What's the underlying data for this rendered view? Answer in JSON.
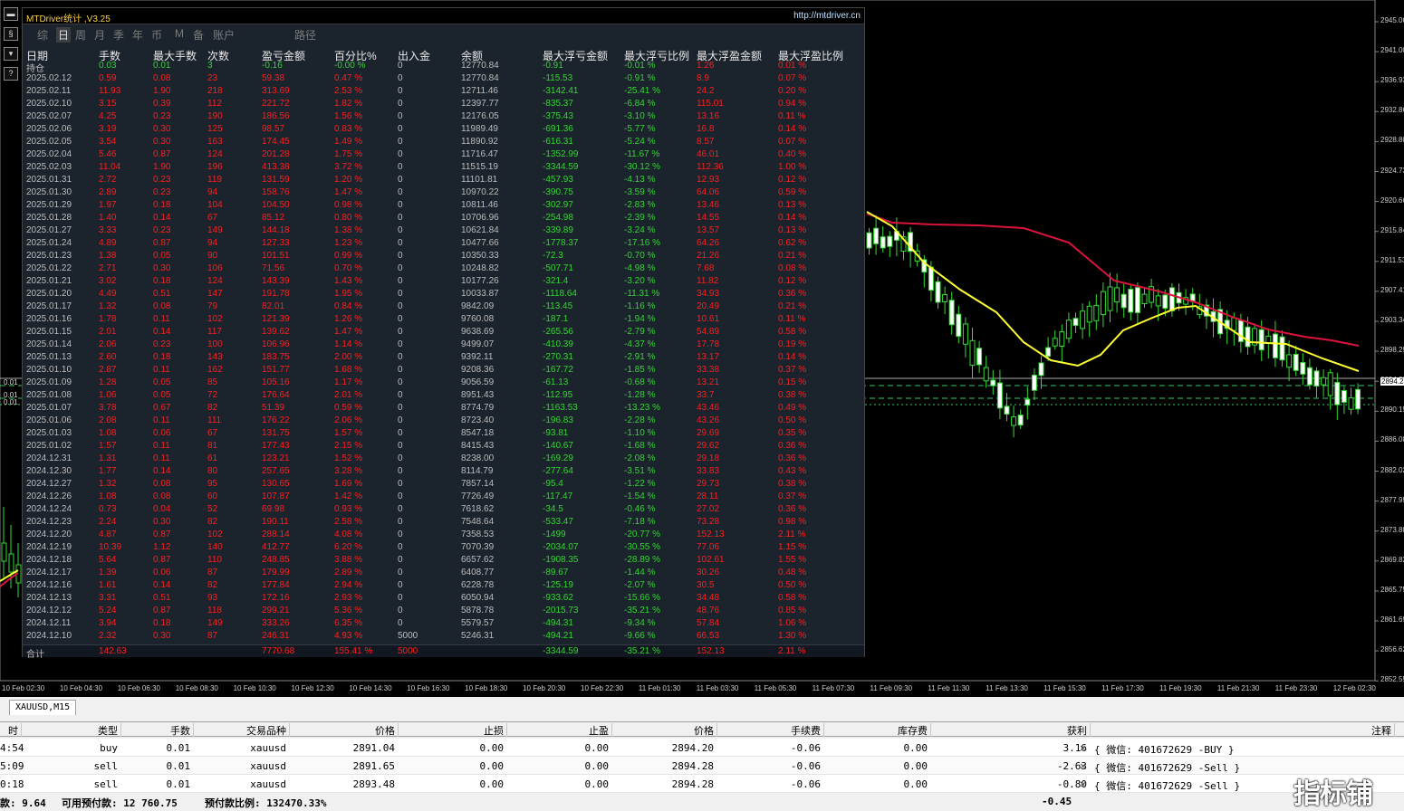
{
  "panel": {
    "title": "MTDriver统计 ,V3.25",
    "url": "http://mtdriver.cn",
    "tabs": [
      "综",
      "日",
      "周",
      "月",
      "季",
      "年",
      "币",
      "M",
      "备",
      "账户",
      "",
      "路径"
    ],
    "active_tab": 1,
    "headers": [
      "日期",
      "手数",
      "最大手数",
      "次数",
      "盈亏金额",
      "百分比%",
      "出入金",
      "余额",
      "最大浮亏金额",
      "最大浮亏比例",
      "最大浮盈金额",
      "最大浮盈比例"
    ],
    "holding": [
      "持仓",
      "0.03",
      "0.01",
      "3",
      "-0.16",
      "-0.00 %",
      "0",
      "12770.84",
      "-0.91",
      "-0.01 %",
      "1.26",
      "0.01 %"
    ],
    "rows": [
      [
        "2025.02.12",
        "0.59",
        "0.08",
        "23",
        "59.38",
        "0.47 %",
        "0",
        "12770.84",
        "-115.53",
        "-0.91 %",
        "8.9",
        "0.07 %"
      ],
      [
        "2025.02.11",
        "11.93",
        "1.90",
        "218",
        "313.69",
        "2.53 %",
        "0",
        "12711.46",
        "-3142.41",
        "-25.41 %",
        "24.2",
        "0.20 %"
      ],
      [
        "2025.02.10",
        "3.15",
        "0.39",
        "112",
        "221.72",
        "1.82 %",
        "0",
        "12397.77",
        "-835.37",
        "-6.84 %",
        "115.01",
        "0.94 %"
      ],
      [
        "2025.02.07",
        "4.25",
        "0.23",
        "190",
        "186.56",
        "1.56 %",
        "0",
        "12176.05",
        "-375.43",
        "-3.10 %",
        "13.16",
        "0.11 %"
      ],
      [
        "2025.02.06",
        "3.19",
        "0.30",
        "125",
        "98.57",
        "0.83 %",
        "0",
        "11989.49",
        "-691.36",
        "-5.77 %",
        "16.8",
        "0.14 %"
      ],
      [
        "2025.02.05",
        "3.54",
        "0.30",
        "163",
        "174.45",
        "1.49 %",
        "0",
        "11890.92",
        "-616.31",
        "-5.24 %",
        "8.57",
        "0.07 %"
      ],
      [
        "2025.02.04",
        "5.46",
        "0.87",
        "124",
        "201.28",
        "1.75 %",
        "0",
        "11716.47",
        "-1352.99",
        "-11.67 %",
        "46.01",
        "0.40 %"
      ],
      [
        "2025.02.03",
        "11.04",
        "1.90",
        "196",
        "413.38",
        "3.72 %",
        "0",
        "11515.19",
        "-3344.59",
        "-30.12 %",
        "112.36",
        "1.00 %"
      ],
      [
        "2025.01.31",
        "2.72",
        "0.23",
        "119",
        "131.59",
        "1.20 %",
        "0",
        "11101.81",
        "-457.93",
        "-4.13 %",
        "12.93",
        "0.12 %"
      ],
      [
        "2025.01.30",
        "2.89",
        "0.23",
        "94",
        "158.76",
        "1.47 %",
        "0",
        "10970.22",
        "-390.75",
        "-3.59 %",
        "64.06",
        "0.59 %"
      ],
      [
        "2025.01.29",
        "1.97",
        "0.18",
        "104",
        "104.50",
        "0.98 %",
        "0",
        "10811.46",
        "-302.97",
        "-2.83 %",
        "13.46",
        "0.13 %"
      ],
      [
        "2025.01.28",
        "1.40",
        "0.14",
        "67",
        "85.12",
        "0.80 %",
        "0",
        "10706.96",
        "-254.98",
        "-2.39 %",
        "14.55",
        "0.14 %"
      ],
      [
        "2025.01.27",
        "3.33",
        "0.23",
        "149",
        "144.18",
        "1.38 %",
        "0",
        "10621.84",
        "-339.89",
        "-3.24 %",
        "13.57",
        "0.13 %"
      ],
      [
        "2025.01.24",
        "4.89",
        "0.87",
        "94",
        "127.33",
        "1.23 %",
        "0",
        "10477.66",
        "-1778.37",
        "-17.16 %",
        "64.26",
        "0.62 %"
      ],
      [
        "2025.01.23",
        "1.38",
        "0.05",
        "90",
        "101.51",
        "0.99 %",
        "0",
        "10350.33",
        "-72.3",
        "-0.70 %",
        "21.26",
        "0.21 %"
      ],
      [
        "2025.01.22",
        "2.71",
        "0.30",
        "106",
        "71.56",
        "0.70 %",
        "0",
        "10248.82",
        "-507.71",
        "-4.98 %",
        "7.68",
        "0.08 %"
      ],
      [
        "2025.01.21",
        "3.02",
        "0.18",
        "124",
        "143.39",
        "1.43 %",
        "0",
        "10177.26",
        "-321.4",
        "-3.20 %",
        "11.82",
        "0.12 %"
      ],
      [
        "2025.01.20",
        "4.49",
        "0.51",
        "147",
        "191.78",
        "1.95 %",
        "0",
        "10033.87",
        "-1118.64",
        "-11.31 %",
        "34.93",
        "0.36 %"
      ],
      [
        "2025.01.17",
        "1.32",
        "0.08",
        "79",
        "82.01",
        "0.84 %",
        "0",
        "9842.09",
        "-113.45",
        "-1.16 %",
        "20.49",
        "0.21 %"
      ],
      [
        "2025.01.16",
        "1.78",
        "0.11",
        "102",
        "121.39",
        "1.26 %",
        "0",
        "9760.08",
        "-187.1",
        "-1.94 %",
        "10.61",
        "0.11 %"
      ],
      [
        "2025.01.15",
        "2.01",
        "0.14",
        "117",
        "139.62",
        "1.47 %",
        "0",
        "9638.69",
        "-265.56",
        "-2.79 %",
        "54.89",
        "0.58 %"
      ],
      [
        "2025.01.14",
        "2.06",
        "0.23",
        "100",
        "106.96",
        "1.14 %",
        "0",
        "9499.07",
        "-410.39",
        "-4.37 %",
        "17.78",
        "0.19 %"
      ],
      [
        "2025.01.13",
        "2.60",
        "0.18",
        "143",
        "183.75",
        "2.00 %",
        "0",
        "9392.11",
        "-270.31",
        "-2.91 %",
        "13.17",
        "0.14 %"
      ],
      [
        "2025.01.10",
        "2.87",
        "0.11",
        "162",
        "151.77",
        "1.68 %",
        "0",
        "9208.36",
        "-167.72",
        "-1.85 %",
        "33.38",
        "0.37 %"
      ],
      [
        "2025.01.09",
        "1.28",
        "0.05",
        "85",
        "105.16",
        "1.17 %",
        "0",
        "9056.59",
        "-61.13",
        "-0.68 %",
        "13.21",
        "0.15 %"
      ],
      [
        "2025.01.08",
        "1.06",
        "0.05",
        "72",
        "176.64",
        "2.01 %",
        "0",
        "8951.43",
        "-112.95",
        "-1.28 %",
        "33.7",
        "0.38 %"
      ],
      [
        "2025.01.07",
        "3.78",
        "0.67",
        "82",
        "51.39",
        "0.59 %",
        "0",
        "8774.79",
        "-1163.53",
        "-13.23 %",
        "43.46",
        "0.49 %"
      ],
      [
        "2025.01.06",
        "2.08",
        "0.11",
        "111",
        "176.22",
        "2.06 %",
        "0",
        "8723.40",
        "-196.83",
        "-2.28 %",
        "43.26",
        "0.50 %"
      ],
      [
        "2025.01.03",
        "1.08",
        "0.06",
        "67",
        "131.75",
        "1.57 %",
        "0",
        "8547.18",
        "-93.81",
        "-1.10 %",
        "29.69",
        "0.35 %"
      ],
      [
        "2025.01.02",
        "1.57",
        "0.11",
        "81",
        "177.43",
        "2.15 %",
        "0",
        "8415.43",
        "-140.67",
        "-1.68 %",
        "29.62",
        "0.36 %"
      ],
      [
        "2024.12.31",
        "1.31",
        "0.11",
        "61",
        "123.21",
        "1.52 %",
        "0",
        "8238.00",
        "-169.29",
        "-2.08 %",
        "29.18",
        "0.36 %"
      ],
      [
        "2024.12.30",
        "1.77",
        "0.14",
        "80",
        "257.65",
        "3.28 %",
        "0",
        "8114.79",
        "-277.64",
        "-3.51 %",
        "33.83",
        "0.43 %"
      ],
      [
        "2024.12.27",
        "1.32",
        "0.08",
        "95",
        "130.65",
        "1.69 %",
        "0",
        "7857.14",
        "-95.4",
        "-1.22 %",
        "29.73",
        "0.38 %"
      ],
      [
        "2024.12.26",
        "1.08",
        "0.08",
        "60",
        "107.87",
        "1.42 %",
        "0",
        "7726.49",
        "-117.47",
        "-1.54 %",
        "28.11",
        "0.37 %"
      ],
      [
        "2024.12.24",
        "0.73",
        "0.04",
        "52",
        "69.98",
        "0.93 %",
        "0",
        "7618.62",
        "-34.5",
        "-0.46 %",
        "27.02",
        "0.36 %"
      ],
      [
        "2024.12.23",
        "2.24",
        "0.30",
        "82",
        "190.11",
        "2.58 %",
        "0",
        "7548.64",
        "-533.47",
        "-7.18 %",
        "73.28",
        "0.98 %"
      ],
      [
        "2024.12.20",
        "4.87",
        "0.87",
        "102",
        "288.14",
        "4.08 %",
        "0",
        "7358.53",
        "-1499",
        "-20.77 %",
        "152.13",
        "2.11 %"
      ],
      [
        "2024.12.19",
        "10.39",
        "1.12",
        "140",
        "412.77",
        "6.20 %",
        "0",
        "7070.39",
        "-2034.07",
        "-30.55 %",
        "77.06",
        "1.15 %"
      ],
      [
        "2024.12.18",
        "5.64",
        "0.87",
        "110",
        "248.85",
        "3.88 %",
        "0",
        "6657.62",
        "-1908.35",
        "-28.89 %",
        "102.61",
        "1.55 %"
      ],
      [
        "2024.12.17",
        "1.39",
        "0.06",
        "87",
        "179.99",
        "2.89 %",
        "0",
        "6408.77",
        "-89.67",
        "-1.44 %",
        "30.26",
        "0.48 %"
      ],
      [
        "2024.12.16",
        "1.61",
        "0.14",
        "82",
        "177.84",
        "2.94 %",
        "0",
        "6228.78",
        "-125.19",
        "-2.07 %",
        "30.5",
        "0.50 %"
      ],
      [
        "2024.12.13",
        "3.31",
        "0.51",
        "93",
        "172.16",
        "2.93 %",
        "0",
        "6050.94",
        "-933.62",
        "-15.66 %",
        "34.48",
        "0.58 %"
      ],
      [
        "2024.12.12",
        "5.24",
        "0.87",
        "118",
        "299.21",
        "5.36 %",
        "0",
        "5878.78",
        "-2015.73",
        "-35.21 %",
        "48.76",
        "0.85 %"
      ],
      [
        "2024.12.11",
        "3.94",
        "0.18",
        "149",
        "333.26",
        "6.35 %",
        "0",
        "5579.57",
        "-494.31",
        "-9.34 %",
        "57.84",
        "1.06 %"
      ],
      [
        "2024.12.10",
        "2.32",
        "0.30",
        "87",
        "246.31",
        "4.93 %",
        "5000",
        "5246.31",
        "-494.21",
        "-9.66 %",
        "66.53",
        "1.30 %"
      ]
    ],
    "total": [
      "合计",
      "142.63",
      "",
      "",
      "7770.68",
      "155.41 %",
      "5000",
      "",
      "-3344.59",
      "-35.21 %",
      "152.13",
      "2.11 %"
    ]
  },
  "chart": {
    "price_labels": [
      "2945.06",
      "2941.00",
      "2936.93",
      "2932.86",
      "2928.80",
      "2924.73",
      "2920.66",
      "2915.84",
      "2911.53",
      "2907.41",
      "2903.34",
      "2898.29",
      "2894.28",
      "2890.15",
      "2886.08",
      "2882.02",
      "2877.95",
      "2873.88",
      "2869.82",
      "2865.75",
      "2861.69",
      "2856.62",
      "2852.55"
    ],
    "current_price": "2894.28",
    "time_labels": [
      "10 Feb 02:30",
      "10 Feb 04:30",
      "10 Feb 06:30",
      "10 Feb 08:30",
      "10 Feb 10:30",
      "10 Feb 12:30",
      "10 Feb 14:30",
      "10 Feb 16:30",
      "10 Feb 18:30",
      "10 Feb 20:30",
      "10 Feb 22:30",
      "11 Feb 01:30",
      "11 Feb 03:30",
      "11 Feb 05:30",
      "11 Feb 07:30",
      "11 Feb 09:30",
      "11 Feb 11:30",
      "11 Feb 13:30",
      "11 Feb 15:30",
      "11 Feb 17:30",
      "11 Feb 19:30",
      "11 Feb 21:30",
      "11 Feb 23:30",
      "12 Feb 02:30"
    ],
    "left_marks": [
      "0.01",
      "0.01",
      "0.01"
    ],
    "colors": {
      "candle": "#33dd33",
      "ma_fast": "#ffff33",
      "ma_slow": "#dc143c",
      "grid": "#33cc66"
    }
  },
  "terminal": {
    "symbol_tab": "XAUUSD,M15",
    "headers": [
      "时间",
      "类型",
      "手数",
      "交易品种",
      "价格",
      "止损",
      "止盈",
      "价格",
      "手续费",
      "库存费",
      "获利",
      "注释"
    ],
    "rows": [
      [
        "4:54",
        "buy",
        "0.01",
        "xauusd",
        "2891.04",
        "0.00",
        "0.00",
        "2894.20",
        "-0.06",
        "0.00",
        "3.16",
        "{ 微信: 401672629 -BUY }"
      ],
      [
        "5:09",
        "sell",
        "0.01",
        "xauusd",
        "2891.65",
        "0.00",
        "0.00",
        "2894.28",
        "-0.06",
        "0.00",
        "-2.63",
        "{ 微信: 401672629 -Sell }"
      ],
      [
        "0:18",
        "sell",
        "0.01",
        "xauusd",
        "2893.48",
        "0.00",
        "0.00",
        "2894.28",
        "-0.06",
        "0.00",
        "-0.80",
        "{ 微信: 401672629 -Sell }"
      ]
    ],
    "status": {
      "free_margin_prefix": "款: 9.64",
      "available_label": "可用预付款: 12 760.75",
      "ratio_label": "预付款比例: 132470.33%",
      "total_profit": "-0.45"
    }
  },
  "watermark": "指标铺"
}
